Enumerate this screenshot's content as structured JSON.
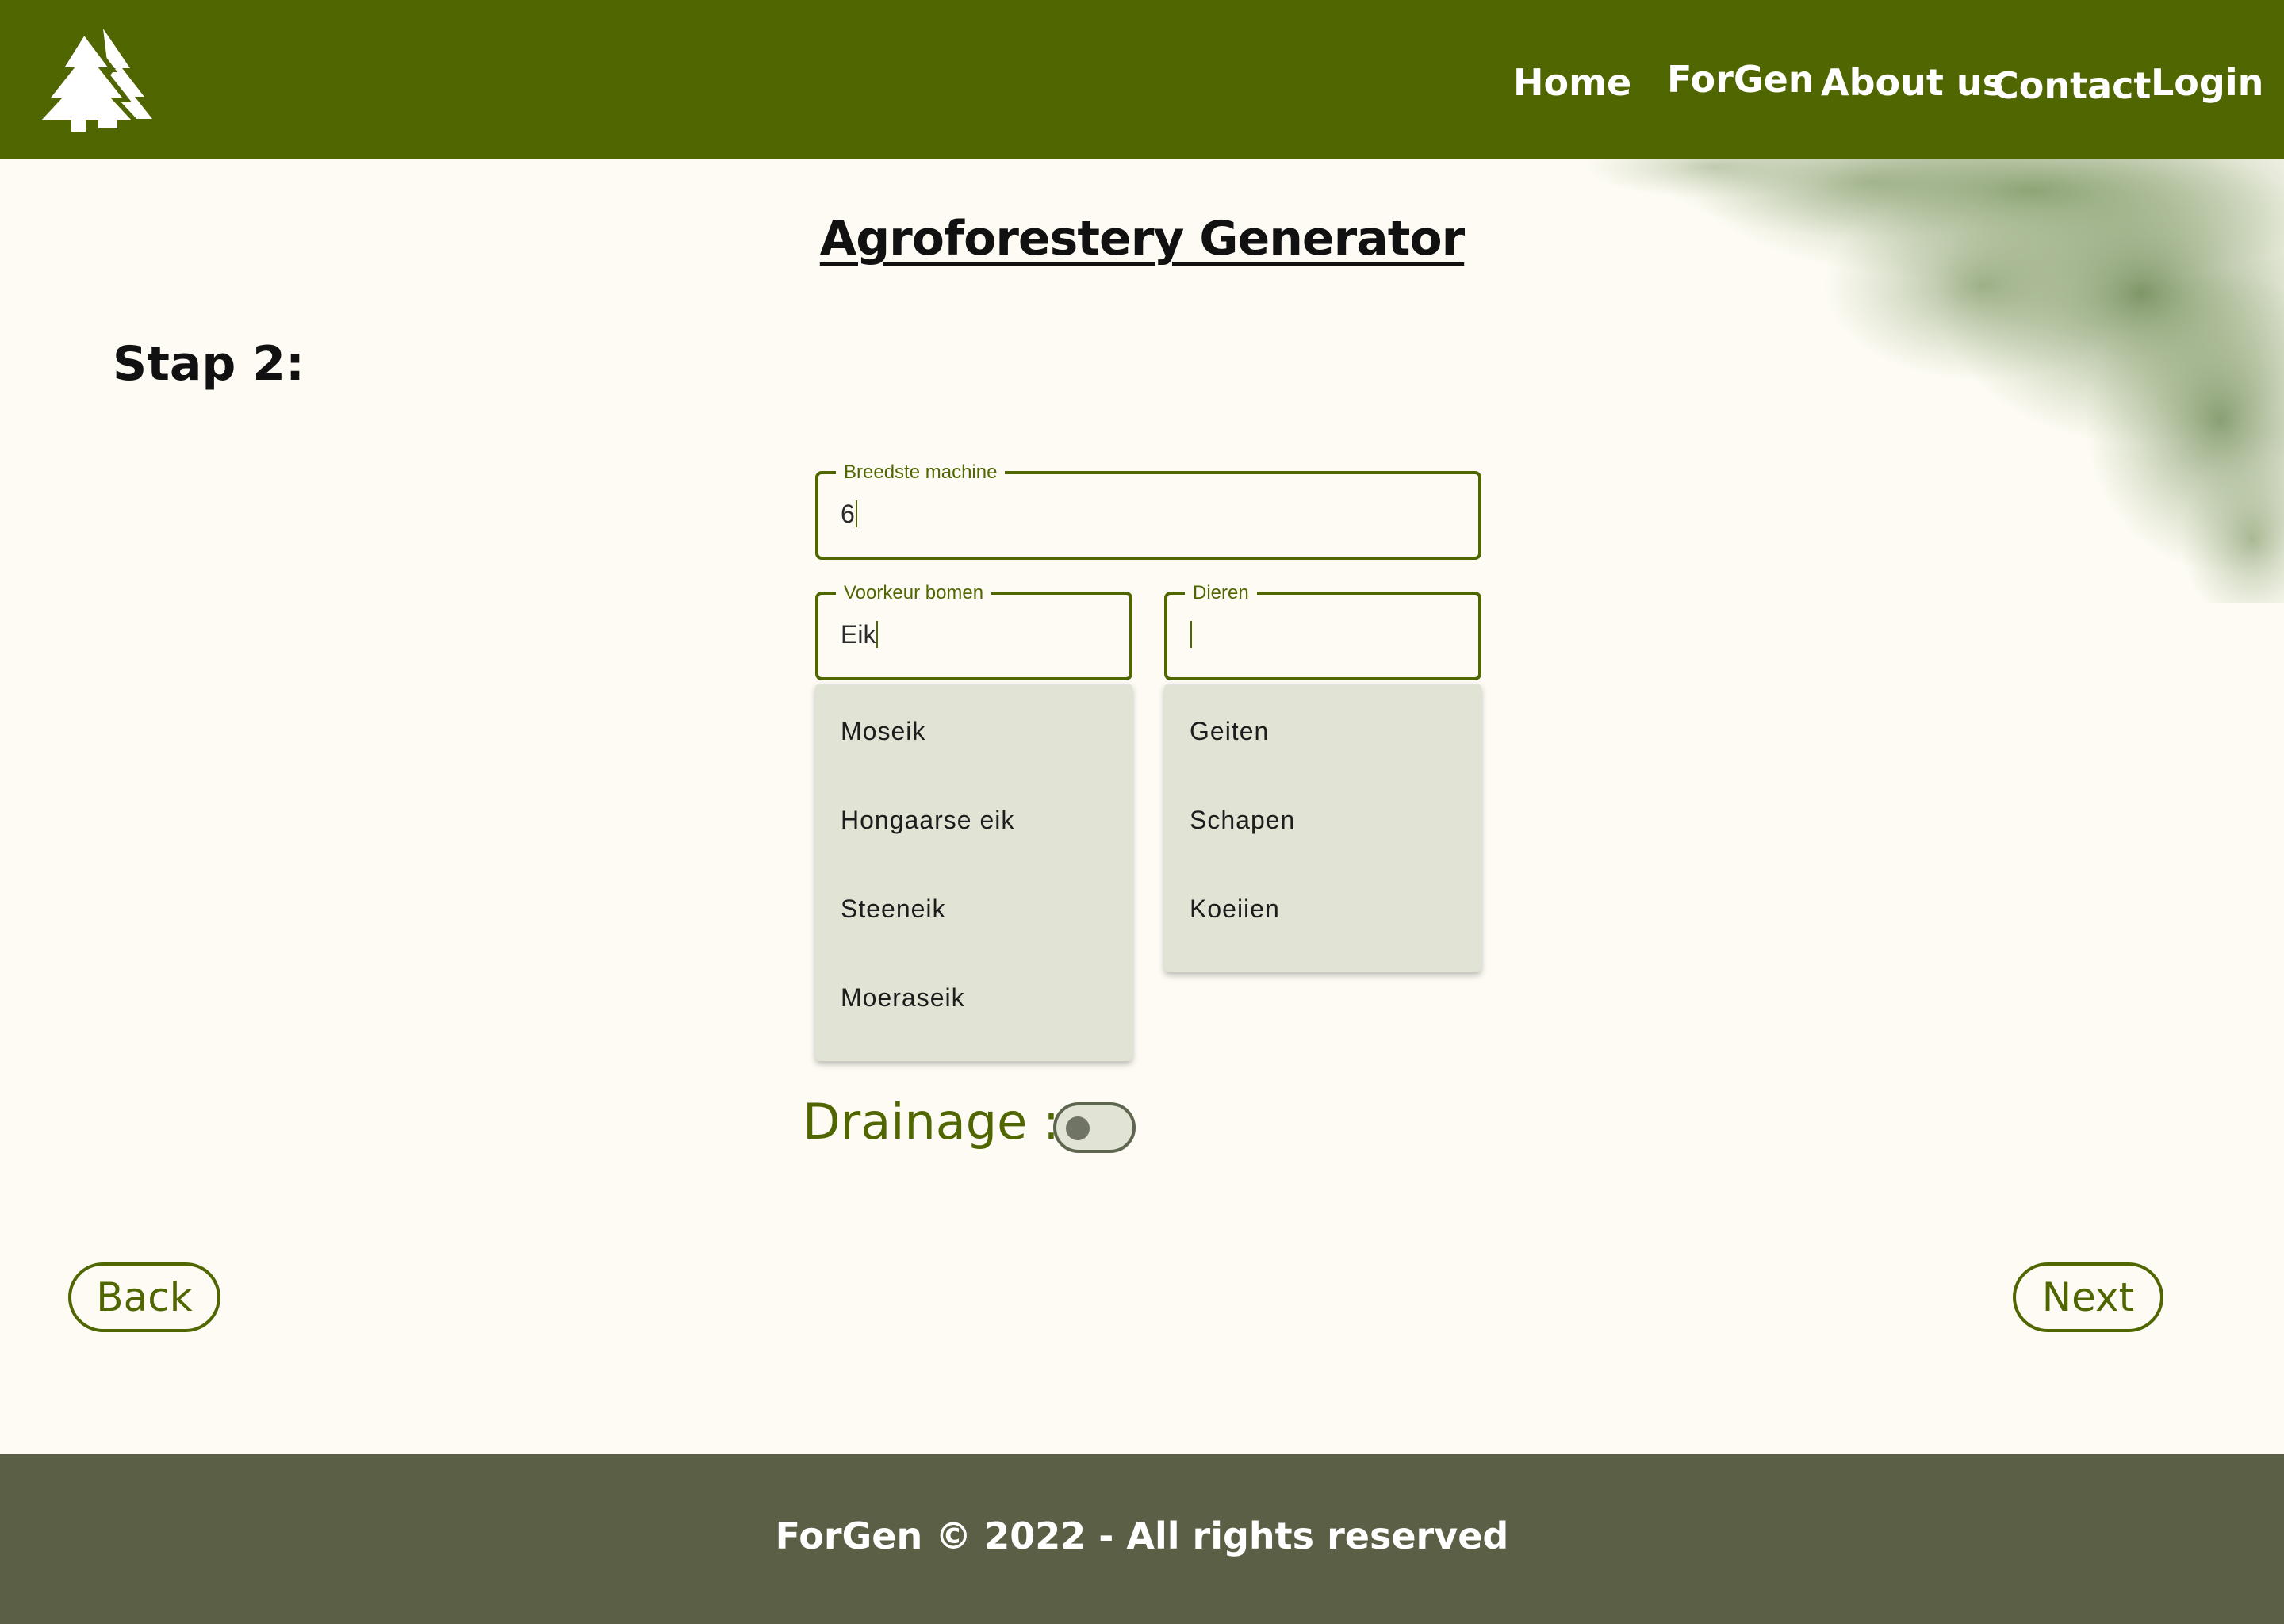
{
  "header": {
    "logo_alt": "ForGen trees logo",
    "nav": [
      "Home",
      "ForGen",
      "About us",
      "Contact",
      "Login"
    ]
  },
  "title": "Agroforestery Generator",
  "step": "Stap 2:",
  "fields": {
    "machine": {
      "label": "Breedste machine",
      "value": "6"
    },
    "trees": {
      "label": "Voorkeur bomen",
      "value": "Eik"
    },
    "animals": {
      "label": "Dieren",
      "value": ""
    }
  },
  "tree_options": [
    "Moseik",
    "Hongaarse eik",
    "Steeneik",
    "Moeraseik"
  ],
  "animal_options": [
    "Geiten",
    "Schapen",
    "Koeiien"
  ],
  "drainage": {
    "label": "Drainage :",
    "enabled": false
  },
  "buttons": {
    "back": "Back",
    "next": "Next"
  },
  "footer": "ForGen © 2022 - All rights reserved",
  "colors": {
    "primary": "#506600",
    "background": "#fdfbf3",
    "dropdown": "#e1e4d5",
    "footer": "#5b5f45"
  },
  "icons": {
    "logo": "pine-trees-icon",
    "decoration": "tree-foliage"
  }
}
